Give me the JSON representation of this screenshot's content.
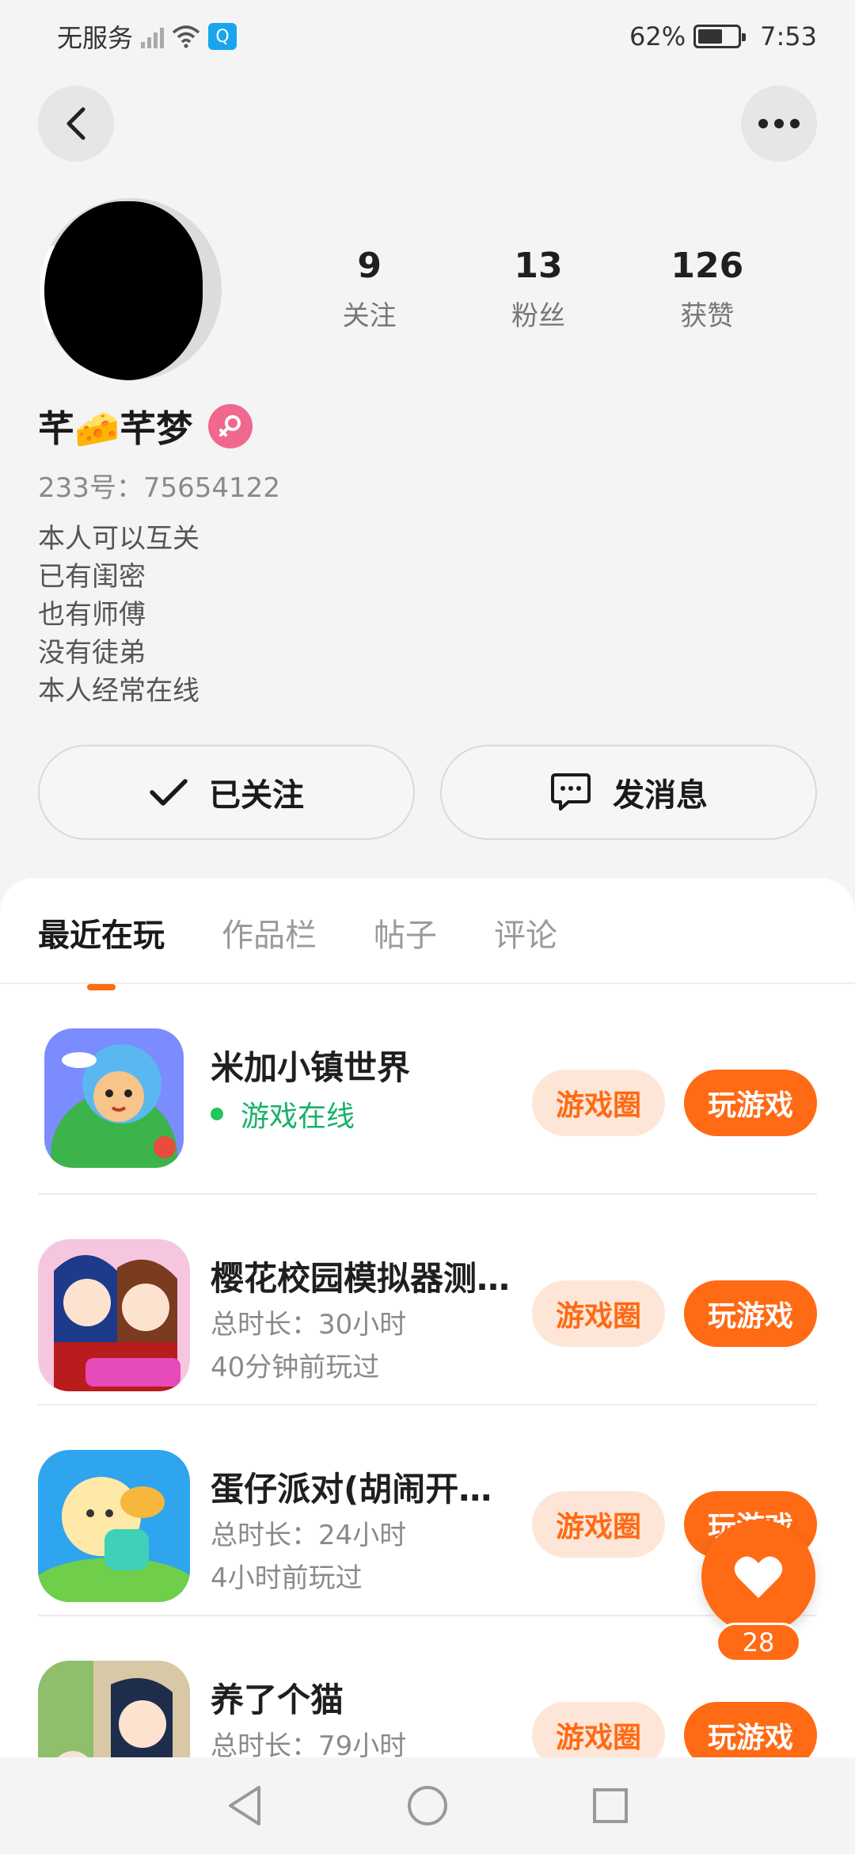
{
  "status_bar": {
    "carrier": "无服务",
    "battery": "62%",
    "battery_level": 0.62,
    "time": "7:53"
  },
  "profile": {
    "nickname": "芊🧀芊梦",
    "uid": "233号：75654122",
    "bio": [
      "本人可以互关",
      "已有闺密",
      "也有师傅",
      "没有徒弟",
      "本人经常在线"
    ],
    "stats": [
      {
        "value": "9",
        "label": "关注"
      },
      {
        "value": "13",
        "label": "粉丝"
      },
      {
        "value": "126",
        "label": "获赞"
      }
    ]
  },
  "actions": {
    "follow_label": "已关注",
    "message_label": "发消息"
  },
  "tabs": [
    "最近在玩",
    "作品栏",
    "帖子",
    "评论"
  ],
  "games": [
    {
      "title": "米加小镇世界",
      "status": "游戏在线",
      "circle": "游戏圈",
      "play": "玩游戏"
    },
    {
      "title": "樱花校园模拟器测…",
      "duration": "总时长：30小时",
      "last": "40分钟前玩过",
      "circle": "游戏圈",
      "play": "玩游戏"
    },
    {
      "title": "蛋仔派对(胡闹开…",
      "duration": "总时长：24小时",
      "last": "4小时前玩过",
      "circle": "游戏圈",
      "play": "玩游戏"
    },
    {
      "title": "养了个猫",
      "duration": "总时长：79小时",
      "circle": "游戏圈",
      "play": "玩游戏"
    }
  ],
  "like_count": "28",
  "colors": {
    "accent": "#ff6a14",
    "online": "#17b26a",
    "tag_bg": "#fde6d8",
    "gender": "#f0688d"
  }
}
